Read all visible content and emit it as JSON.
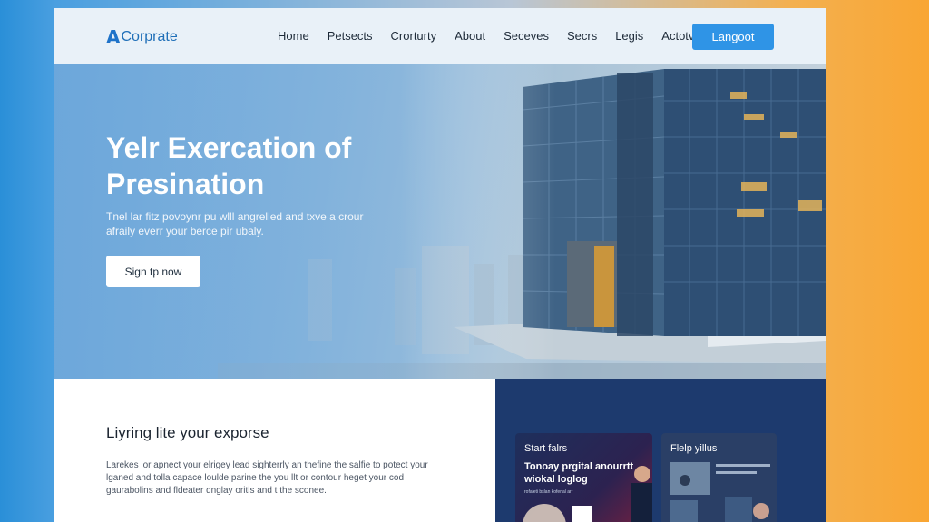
{
  "navbar": {
    "logo_mark": "A",
    "logo_text": "Corprate",
    "links": [
      "Home",
      "Petsects",
      "Crorturty",
      "About",
      "Seceves",
      "Secrs",
      "Legis",
      "Actotv"
    ],
    "login_label": "Langoot"
  },
  "hero": {
    "title": "Yelr Exercation of Presination",
    "subtitle": "Tnel lar fitz povoynr pu wlll angrelled and txve a crour afraily everr your berce pir ubaly.",
    "cta_label": "Sign tp now"
  },
  "lower": {
    "title": "Liyring lite your exporse",
    "text": "Larekes lor apnect your elrigey lead sighterrly an thefine the salfie to potect your lganed and tolla capace loulde parine the you llt or contour heget your cod gaurabolins and fldeater dnglay oritls and t the sconee."
  },
  "cards": [
    {
      "label": "Start falrs",
      "heading": "Tonoay prgital anourrtt wiokal loglog",
      "small": "rofaleti bslan kofenal arr"
    },
    {
      "label": "Flelp yillus",
      "heading": "",
      "small": ""
    }
  ],
  "colors": {
    "accent": "#2f94e6",
    "brand": "#1f73c9",
    "dark_panel": "#1d3a6e"
  }
}
